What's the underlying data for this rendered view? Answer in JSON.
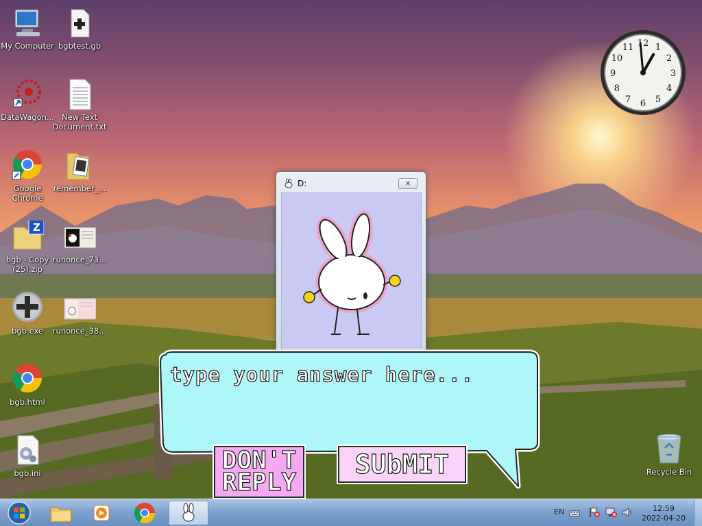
{
  "desktop": {
    "icons": [
      {
        "label": "My Computer",
        "icon": "computer-icon"
      },
      {
        "label": "bgbtest.gb",
        "icon": "gb-file-icon"
      },
      {
        "label": "DataWagon...",
        "icon": "datawagon-icon"
      },
      {
        "label": "New Text Document.txt",
        "icon": "text-file-icon"
      },
      {
        "label": "Google Chrome",
        "icon": "chrome-icon"
      },
      {
        "label": "remember_...",
        "icon": "folder-icon"
      },
      {
        "label": "bgb - Copy (25).zip",
        "icon": "zip-folder-icon"
      },
      {
        "label": "runonce_73...",
        "icon": "image-file-icon"
      },
      {
        "label": "bgb.exe",
        "icon": "gamepad-icon"
      },
      {
        "label": "runonce_38...",
        "icon": "image-file-icon"
      },
      {
        "label": "bgb.html",
        "icon": "chrome-icon"
      },
      {
        "label": "bgb.ini",
        "icon": "ini-file-icon"
      },
      {
        "label": "Recycle Bin",
        "icon": "recycle-bin-icon"
      }
    ]
  },
  "clock": {
    "time": "12:59",
    "numbers": [
      "12",
      "1",
      "2",
      "3",
      "4",
      "5",
      "6",
      "7",
      "8",
      "9",
      "10",
      "11"
    ]
  },
  "window": {
    "title": "D:",
    "close_symbol": "⨯"
  },
  "dialog": {
    "placeholder": "type your answer here...",
    "dont_reply_line1": "DON'T",
    "dont_reply_line2": "REPLY",
    "submit_label": "SUbMIT"
  },
  "taskbar": {
    "items": [
      "start-button",
      "explorer",
      "media-player",
      "chrome",
      "bunny-app"
    ],
    "tray": {
      "language": "EN",
      "time": "12:59",
      "date": "2022-04-20"
    }
  },
  "colors": {
    "bubble": "#aef7f8",
    "dont_reply": "#f4a9f2",
    "submit": "#f9d4f8",
    "window_client": "#c9c9f4"
  }
}
